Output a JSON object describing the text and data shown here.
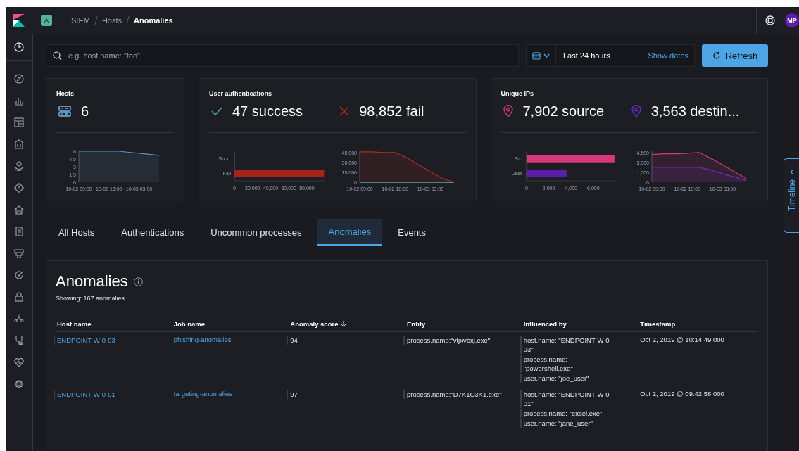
{
  "header": {
    "space_badge": "A",
    "breadcrumbs": [
      {
        "label": "SIEM",
        "current": false
      },
      {
        "label": "Hosts",
        "current": false
      },
      {
        "label": "Anomalies",
        "current": true
      }
    ],
    "avatar": "MP"
  },
  "query_bar": {
    "placeholder": "e.g. host.name: \"foo\""
  },
  "date_picker": {
    "range": "Last 24 hours",
    "show_dates": "Show dates"
  },
  "refresh_button": "Refresh",
  "stat_cards": [
    {
      "title": "Hosts",
      "stats": [
        {
          "kind": "server",
          "color": "#6092c0",
          "value": "6"
        }
      ],
      "charts": [
        {
          "chart_data": {
            "type": "area",
            "categories": [
              "10-02 09:00",
              null,
              null,
              "10-02 18:00",
              null,
              null,
              "10-03 03:00",
              null,
              null
            ],
            "series": [
              {
                "color": "#6092c0",
                "values": [
                  6,
                  6,
                  6,
                  6,
                  6,
                  5.8,
                  5.6,
                  5.4,
                  5.2
                ]
              }
            ],
            "ylim": [
              0,
              6
            ],
            "yticks": [
              0,
              1.5,
              3,
              4.5,
              6
            ]
          }
        }
      ]
    },
    {
      "title": "User authentications",
      "stats": [
        {
          "kind": "check",
          "color": "#54b399",
          "value": "47 success"
        },
        {
          "kind": "cross",
          "color": "#bd271e",
          "value": "98,852 fail"
        }
      ],
      "charts": [
        {
          "chart_data": {
            "type": "bar",
            "orientation": "horizontal",
            "stacked": true,
            "categories": [
              "Succ.",
              "Fail"
            ],
            "series": [
              {
                "color": "#a8231b",
                "values": [
                  null,
                  99000
                ]
              }
            ],
            "xlim": [
              0,
              99500
            ],
            "xticks": [
              0,
              {
                "value": 20000,
                "label": "20,000"
              },
              {
                "value": 40000,
                "label": "40,000"
              },
              {
                "value": 60000,
                "label": "60,000"
              },
              {
                "value": 80000,
                "label": "80,000"
              }
            ]
          }
        },
        {
          "chart_data": {
            "type": "area",
            "categories": [
              "10-02 09:00",
              null,
              null,
              "10-02 18:00",
              null,
              null,
              "10-03 03:00",
              null,
              null
            ],
            "series": [
              {
                "type": "line",
                "color": "#54b399",
                "values": [
                  0,
                  0,
                  0,
                  0,
                  0,
                  0,
                  0,
                  0,
                  0
                ]
              },
              {
                "color": "#bd271e",
                "values": [
                  47000,
                  47000,
                  46000,
                  46000,
                  38000,
                  27000,
                  16000,
                  6000,
                  0
                ]
              }
            ],
            "ylim": [
              0,
              48000
            ],
            "yticks": [
              0,
              {
                "value": 15000,
                "label": "15,000"
              },
              {
                "value": 30000,
                "label": "30,000"
              },
              {
                "value": 45000,
                "label": "45,000"
              }
            ]
          }
        }
      ]
    },
    {
      "title": "Unique IPs",
      "stats": [
        {
          "kind": "pin",
          "color": "#d6397a",
          "value": "7,902 source"
        },
        {
          "kind": "pin",
          "color": "#6a2cc0",
          "value": "3,563 destin..."
        }
      ],
      "charts": [
        {
          "chart_data": {
            "type": "bar",
            "orientation": "horizontal",
            "stacked": true,
            "categories": [
              "Src.",
              "Dest."
            ],
            "series": [
              {
                "color": "#d6397a",
                "values": [
                  7900,
                  null
                ]
              },
              {
                "color": "#5a1fa8",
                "values": [
                  null,
                  3600
                ]
              }
            ],
            "xlim": [
              0,
              8100
            ],
            "xticks": [
              0,
              {
                "value": 2000,
                "label": "2,000"
              },
              {
                "value": 4000,
                "label": "4,000"
              },
              {
                "value": 6000,
                "label": "6,000"
              }
            ]
          }
        },
        {
          "chart_data": {
            "type": "area",
            "categories": [
              "10-02 09:00",
              null,
              null,
              "10-02 18:00",
              null,
              null,
              "10-03 03:00",
              null,
              null
            ],
            "series": [
              {
                "color": "#d6397a",
                "values": [
                  4300,
                  4400,
                  4400,
                  4500,
                  4600,
                  3700,
                  2700,
                  1600,
                  600
                ]
              },
              {
                "color": "#6a2cc0",
                "values": [
                  2300,
                  2300,
                  2300,
                  2300,
                  2300,
                  1900,
                  1300,
                  800,
                  300
                ]
              }
            ],
            "ylim": [
              0,
              4800
            ],
            "yticks": [
              0,
              {
                "value": 1500,
                "label": "1,500"
              },
              {
                "value": 3000,
                "label": "3,000"
              },
              {
                "value": 4500,
                "label": "4,500"
              }
            ]
          }
        }
      ]
    }
  ],
  "tabs": [
    {
      "label": "All Hosts",
      "selected": false
    },
    {
      "label": "Authentications",
      "selected": false
    },
    {
      "label": "Uncommon processes",
      "selected": false
    },
    {
      "label": "Anomalies",
      "selected": true
    },
    {
      "label": "Events",
      "selected": false
    }
  ],
  "anomalies": {
    "title": "Anomalies",
    "subtitle": "Showing: 167 anomalies",
    "columns": [
      {
        "label": "Host name",
        "sorted": false
      },
      {
        "label": "Job name",
        "sorted": false
      },
      {
        "label": "Anomaly score",
        "sorted": true
      },
      {
        "label": "Entity",
        "sorted": false
      },
      {
        "label": "Influenced by",
        "sorted": false
      },
      {
        "label": "Timestamp",
        "sorted": false
      }
    ],
    "rows": [
      {
        "host": "ENDPOINT-W-0-03",
        "job": "phishing-anomalies",
        "score": "94",
        "entity": "process.name:\"vtjxvbxj.exe\"",
        "influencers": [
          "host.name: \"ENDPOINT-W-0-03\"",
          "process.name: \"powershell.exe\"",
          "user.name: \"joe_user\""
        ],
        "timestamp": "Oct 2, 2019 @ 10:14:49.000"
      },
      {
        "host": "ENDPOINT-W-0-01",
        "job": "targeting-anomalies",
        "score": "97",
        "entity": "process.name:\"D7K1C3K1.exe\"",
        "influencers": [
          "host.name: \"ENDPOINT-W-0-01\"",
          "process.name: \"excel.exe\"",
          "user.name: \"jane_user\""
        ],
        "timestamp": "Oct 2, 2019 @ 09:42:58.000"
      }
    ]
  },
  "timeline_tab": "Timeline"
}
